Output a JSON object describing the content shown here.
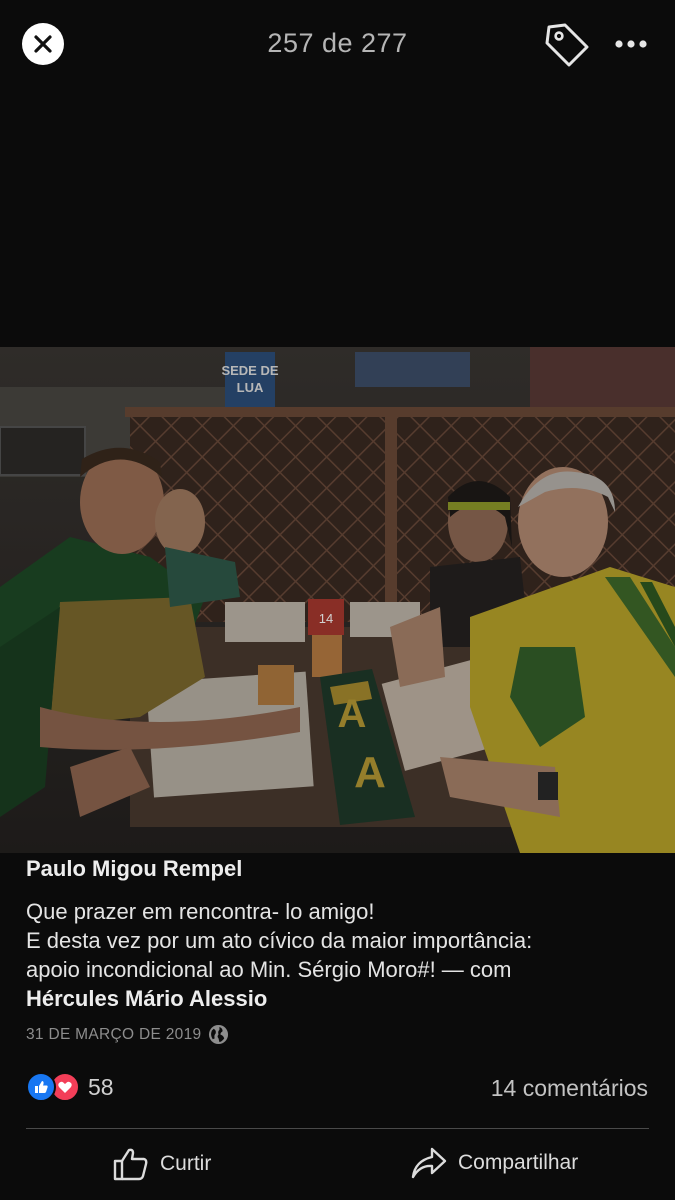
{
  "header": {
    "counter": "257 de 277",
    "close_icon": "close-icon",
    "tag_icon": "tag-icon",
    "more_icon": "more-options-icon"
  },
  "post": {
    "author": "Paulo Migou Rempel",
    "caption_lines": [
      "Que prazer em rencontra- lo amigo!",
      "E desta vez por um ato cívico da maior importância:",
      "apoio incondicional ao Min. Sérgio Moro#! — com"
    ],
    "tagged_person": "Hércules Mário Alessio",
    "date": "31 DE MARÇO DE 2019",
    "privacy_icon": "globe-icon"
  },
  "photo": {
    "description_icon": "photo-image",
    "visible_text": [
      "SEDE DE",
      "LUA",
      "14",
      "A",
      "A"
    ]
  },
  "engagement": {
    "reaction_icons": [
      "like-icon",
      "love-icon"
    ],
    "reaction_count": "58",
    "comments": "14 comentários"
  },
  "actions": {
    "like_label": "Curtir",
    "share_label": "Compartilhar"
  },
  "colors": {
    "background": "#0b0b0b",
    "like_blue": "#1877f2",
    "love_red": "#f33e58"
  }
}
